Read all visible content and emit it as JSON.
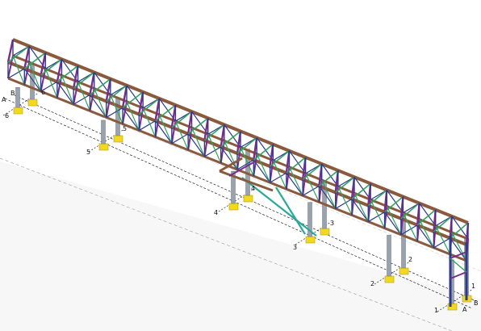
{
  "viewport": {
    "background": "#ffffff",
    "ground_color": "#ececec"
  },
  "colors": {
    "chord": "#8b5a3c",
    "crossbeam": "#7a2c8c",
    "diagonal": "#2fa45c",
    "truss_web": "#2c3a8c",
    "column": "#9aa3ad",
    "column_dark": "#6d7680",
    "bracing": "#2aa998",
    "footing": "#f2d91c",
    "gridline": "#222222",
    "grid_extension": "#9a9a9a"
  },
  "gridlines": {
    "numbered": [
      {
        "label_left": "6",
        "label_right": "6"
      },
      {
        "label_left": "5",
        "label_right": "5"
      },
      {
        "label_left": "4",
        "label_right": "4"
      },
      {
        "label_left": "3",
        "label_right": "3"
      },
      {
        "label_left": "2",
        "label_right": "2"
      },
      {
        "label_left": "1",
        "label_right": "1"
      }
    ],
    "lettered": [
      {
        "label_start": "A",
        "label_end": "A"
      },
      {
        "label_start": "B",
        "label_end": "B"
      }
    ]
  }
}
